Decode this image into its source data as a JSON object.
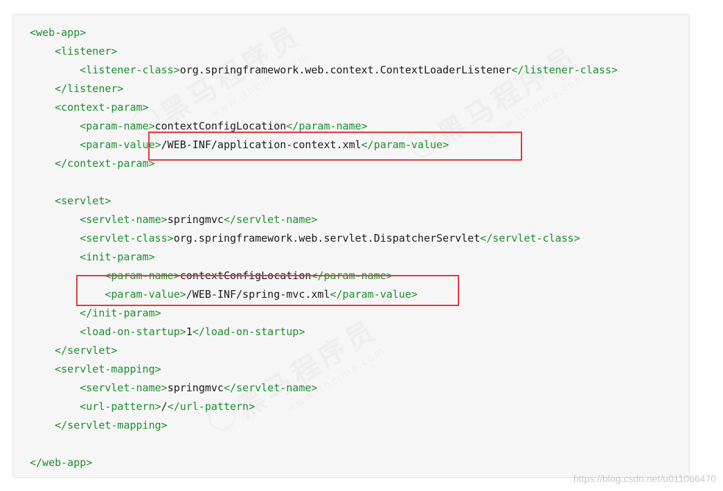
{
  "code_lines": [
    {
      "indent": "",
      "parts": [
        {
          "t": "tag",
          "v": "<web-app>"
        }
      ]
    },
    {
      "indent": "    ",
      "parts": [
        {
          "t": "tag",
          "v": "<listener>"
        }
      ]
    },
    {
      "indent": "        ",
      "parts": [
        {
          "t": "tag",
          "v": "<listener-class>"
        },
        {
          "t": "txt",
          "v": "org.springframework.web.context.ContextLoaderListener"
        },
        {
          "t": "tag",
          "v": "</listener-class>"
        }
      ]
    },
    {
      "indent": "    ",
      "parts": [
        {
          "t": "tag",
          "v": "</listener>"
        }
      ]
    },
    {
      "indent": "    ",
      "parts": [
        {
          "t": "tag",
          "v": "<context-param>"
        }
      ]
    },
    {
      "indent": "        ",
      "parts": [
        {
          "t": "tag",
          "v": "<param-name>"
        },
        {
          "t": "txt",
          "v": "contextConfigLocation"
        },
        {
          "t": "tag",
          "v": "</param-name>"
        }
      ]
    },
    {
      "indent": "        ",
      "parts": [
        {
          "t": "tag",
          "v": "<param-value>"
        },
        {
          "t": "txt",
          "v": "/WEB-INF/application-context.xml"
        },
        {
          "t": "tag",
          "v": "</param-value>"
        }
      ]
    },
    {
      "indent": "    ",
      "parts": [
        {
          "t": "tag",
          "v": "</context-param>"
        }
      ]
    },
    {
      "indent": "",
      "parts": []
    },
    {
      "indent": "    ",
      "parts": [
        {
          "t": "tag",
          "v": "<servlet>"
        }
      ]
    },
    {
      "indent": "        ",
      "parts": [
        {
          "t": "tag",
          "v": "<servlet-name>"
        },
        {
          "t": "txt",
          "v": "springmvc"
        },
        {
          "t": "tag",
          "v": "</servlet-name>"
        }
      ]
    },
    {
      "indent": "        ",
      "parts": [
        {
          "t": "tag",
          "v": "<servlet-class>"
        },
        {
          "t": "txt",
          "v": "org.springframework.web.servlet.DispatcherServlet"
        },
        {
          "t": "tag",
          "v": "</servlet-class>"
        }
      ]
    },
    {
      "indent": "        ",
      "parts": [
        {
          "t": "tag",
          "v": "<init-param>"
        }
      ]
    },
    {
      "indent": "            ",
      "parts": [
        {
          "t": "tag",
          "v": "<param-name>"
        },
        {
          "t": "txt",
          "v": "contextConfigLocation"
        },
        {
          "t": "tag",
          "v": "</param-name>"
        }
      ]
    },
    {
      "indent": "            ",
      "parts": [
        {
          "t": "tag",
          "v": "<param-value>"
        },
        {
          "t": "txt",
          "v": "/WEB-INF/spring-mvc.xml"
        },
        {
          "t": "tag",
          "v": "</param-value>"
        }
      ]
    },
    {
      "indent": "        ",
      "parts": [
        {
          "t": "tag",
          "v": "</init-param>"
        }
      ]
    },
    {
      "indent": "        ",
      "parts": [
        {
          "t": "tag",
          "v": "<load-on-startup>"
        },
        {
          "t": "txt",
          "v": "1"
        },
        {
          "t": "tag",
          "v": "</load-on-startup>"
        }
      ]
    },
    {
      "indent": "    ",
      "parts": [
        {
          "t": "tag",
          "v": "</servlet>"
        }
      ]
    },
    {
      "indent": "    ",
      "parts": [
        {
          "t": "tag",
          "v": "<servlet-mapping>"
        }
      ]
    },
    {
      "indent": "        ",
      "parts": [
        {
          "t": "tag",
          "v": "<servlet-name>"
        },
        {
          "t": "txt",
          "v": "springmvc"
        },
        {
          "t": "tag",
          "v": "</servlet-name>"
        }
      ]
    },
    {
      "indent": "        ",
      "parts": [
        {
          "t": "tag",
          "v": "<url-pattern>"
        },
        {
          "t": "txt",
          "v": "/"
        },
        {
          "t": "tag",
          "v": "</url-pattern>"
        }
      ]
    },
    {
      "indent": "    ",
      "parts": [
        {
          "t": "tag",
          "v": "</servlet-mapping>"
        }
      ]
    },
    {
      "indent": "",
      "parts": []
    },
    {
      "indent": "",
      "parts": [
        {
          "t": "tag",
          "v": "</web-app>"
        }
      ]
    }
  ],
  "colors": {
    "tag": "#1a8f2e",
    "text": "#1a1a1a",
    "highlight": "#e0383e",
    "panel_bg": "#f6f6f6"
  },
  "watermark": {
    "main": "黑马程序员",
    "sub": "www.itheima.com"
  },
  "footer": {
    "url": "https://blog.csdn.net/u011066470"
  }
}
